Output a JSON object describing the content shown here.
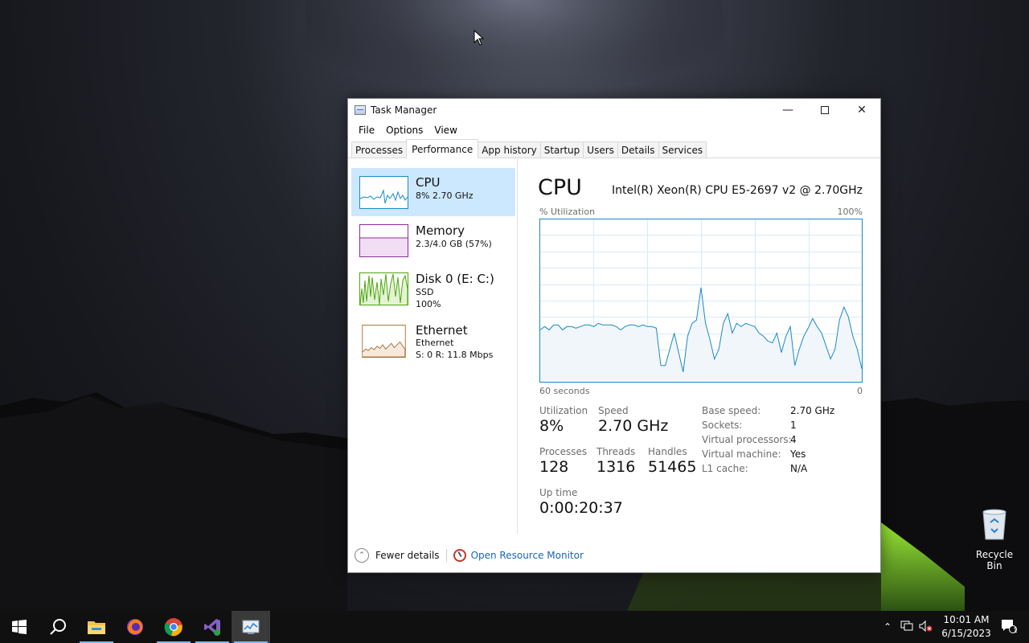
{
  "window": {
    "title": "Task Manager",
    "menu": [
      "File",
      "Options",
      "View"
    ],
    "tabs": [
      "Processes",
      "Performance",
      "App history",
      "Startup",
      "Users",
      "Details",
      "Services"
    ],
    "active_tab": "Performance"
  },
  "sidebar": {
    "items": [
      {
        "label": "CPU",
        "sub1": "8%  2.70 GHz",
        "sub2": "",
        "color": "#1a8ac6",
        "selected": true
      },
      {
        "label": "Memory",
        "sub1": "2.3/4.0 GB (57%)",
        "sub2": "",
        "color": "#8b2c9a",
        "selected": false
      },
      {
        "label": "Disk 0 (E: C:)",
        "sub1": "SSD",
        "sub2": "100%",
        "color": "#4da60c",
        "selected": false
      },
      {
        "label": "Ethernet",
        "sub1": "Ethernet",
        "sub2": "S: 0  R: 11.8 Mbps",
        "color": "#a7672c",
        "selected": false
      }
    ]
  },
  "cpu": {
    "title": "CPU",
    "model": "Intel(R) Xeon(R) CPU E5-2697 v2 @ 2.70GHz",
    "graph_label": "% Utilization",
    "graph_max": "100%",
    "graph_time": "60 seconds",
    "graph_min": "0",
    "stats": {
      "utilization_label": "Utilization",
      "utilization": "8%",
      "speed_label": "Speed",
      "speed": "2.70 GHz",
      "processes_label": "Processes",
      "processes": "128",
      "threads_label": "Threads",
      "threads": "1316",
      "handles_label": "Handles",
      "handles": "51465",
      "uptime_label": "Up time",
      "uptime": "0:00:20:37"
    },
    "specs": [
      {
        "label": "Base speed:",
        "value": "2.70 GHz"
      },
      {
        "label": "Sockets:",
        "value": "1"
      },
      {
        "label": "Virtual processors:",
        "value": "4"
      },
      {
        "label": "Virtual machine:",
        "value": "Yes"
      },
      {
        "label": "L1 cache:",
        "value": "N/A"
      }
    ]
  },
  "chart_data": {
    "type": "area",
    "title": "",
    "xlabel": "60 seconds",
    "ylabel": "% Utilization",
    "xlim": [
      60,
      0
    ],
    "ylim": [
      0,
      100
    ],
    "grid": true,
    "series": [
      {
        "values": [
          32,
          34,
          32,
          35,
          35,
          32,
          34,
          34,
          33,
          34,
          35,
          35,
          34,
          36,
          35,
          35,
          35,
          34,
          32,
          34,
          35,
          35,
          34,
          35,
          34,
          34,
          33,
          10,
          10,
          20,
          30,
          18,
          6,
          28,
          36,
          38,
          58,
          36,
          26,
          14,
          20,
          36,
          42,
          30,
          36,
          34,
          36,
          35,
          34,
          30,
          28,
          25,
          24,
          30,
          18,
          28,
          34,
          10,
          20,
          28,
          33,
          39,
          34,
          30,
          22,
          14,
          20,
          38,
          46,
          40,
          28,
          20,
          8
        ]
      }
    ],
    "color": "#1a8ac6"
  },
  "footer": {
    "fewer_details": "Fewer details",
    "resource_monitor": "Open Resource Monitor"
  },
  "desktop": {
    "recycle_bin": "Recycle Bin"
  },
  "taskbar": {
    "apps": [
      "start-icon",
      "search-icon",
      "file-explorer-icon",
      "firefox-icon",
      "chrome-icon",
      "visual-studio-icon",
      "task-manager-icon"
    ],
    "time": "10:01 AM",
    "date": "6/15/2023",
    "notification_count": "1"
  }
}
